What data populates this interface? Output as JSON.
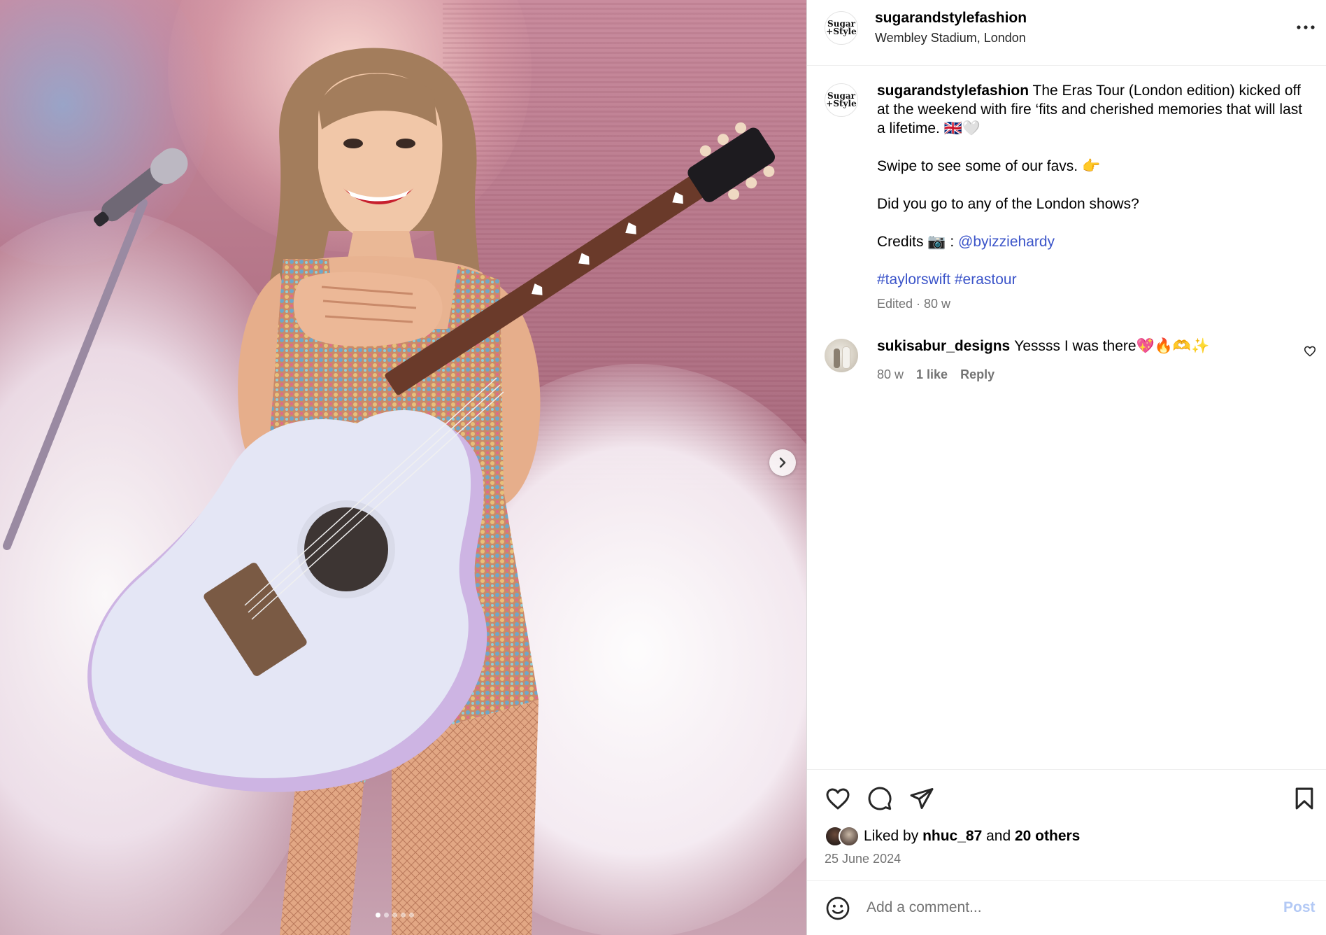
{
  "post": {
    "avatar_logo": {
      "line1": "Sugar",
      "line2": "+Style"
    },
    "username": "sugarandstylefashion",
    "location": "Wembley Stadium, London"
  },
  "caption": {
    "username": "sugarandstylefashion",
    "line1": "The Eras Tour (London edition) kicked off at the weekend with fire ‘fits and cherished memories that will last a lifetime. 🇬🇧🤍",
    "line2": "Swipe to see some of our favs. 👉",
    "line3": "Did you go to any of the London shows?",
    "credits_label": "Credits 📷 : ",
    "credits_handle": "@byizziehardy",
    "hashtag1": "#taylorswift",
    "hashtag2": "#erastour",
    "meta": "Edited · 80 w"
  },
  "comment": {
    "username": "sukisabur_designs",
    "text": "Yessss I was there💖🔥🫶✨",
    "time": "80 w",
    "likes": "1 like",
    "reply": "Reply"
  },
  "likes": {
    "prefix": "Liked by ",
    "user": "nhuc_87",
    "middle": " and ",
    "others": "20 others"
  },
  "date": "25 June 2024",
  "comment_box": {
    "placeholder": "Add a comment...",
    "post_label": "Post"
  },
  "carousel": {
    "slides": 5,
    "active_index": 0
  },
  "colors": {
    "link": "#3b54c9",
    "muted": "#737373",
    "post_disabled": "#b3c9f5",
    "divider": "#efefef"
  }
}
